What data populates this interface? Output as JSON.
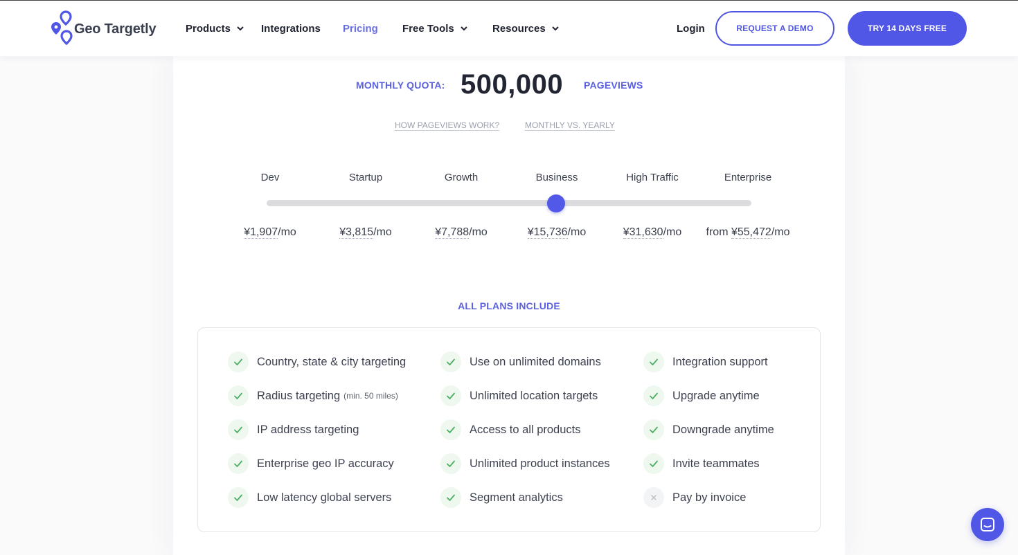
{
  "brand": {
    "name": "Geo Targetly",
    "accent": "#5056e6"
  },
  "nav": {
    "products": "Products",
    "integrations": "Integrations",
    "pricing": "Pricing",
    "free_tools": "Free Tools",
    "resources": "Resources",
    "login": "Login",
    "request_demo": "REQUEST A DEMO",
    "try_free": "TRY 14 DAYS FREE"
  },
  "quota": {
    "label": "MONTHLY QUOTA:",
    "value": "500,000",
    "unit": "PAGEVIEWS",
    "link_how": "HOW PAGEVIEWS WORK?",
    "link_monthly": "MONTHLY VS. YEARLY"
  },
  "tiers": [
    {
      "name": "Dev",
      "prefix": "",
      "amount": "¥1,907",
      "suffix": "/mo"
    },
    {
      "name": "Startup",
      "prefix": "",
      "amount": "¥3,815",
      "suffix": "/mo"
    },
    {
      "name": "Growth",
      "prefix": "",
      "amount": "¥7,788",
      "suffix": "/mo"
    },
    {
      "name": "Business",
      "prefix": "",
      "amount": "¥15,736",
      "suffix": "/mo"
    },
    {
      "name": "High Traffic",
      "prefix": "",
      "amount": "¥31,630",
      "suffix": "/mo"
    },
    {
      "name": "Enterprise",
      "prefix": "from ",
      "amount": "¥55,472",
      "suffix": "/mo"
    }
  ],
  "slider": {
    "selected_index": 3,
    "selected_tier": "Business"
  },
  "plans": {
    "title": "ALL PLANS INCLUDE",
    "columns": [
      [
        {
          "label": "Country, state & city targeting",
          "note": "",
          "included": true
        },
        {
          "label": "Radius targeting",
          "note": "(min. 50 miles)",
          "included": true
        },
        {
          "label": "IP address targeting",
          "note": "",
          "included": true
        },
        {
          "label": "Enterprise geo IP accuracy",
          "note": "",
          "included": true
        },
        {
          "label": "Low latency global servers",
          "note": "",
          "included": true
        }
      ],
      [
        {
          "label": "Use on unlimited domains",
          "note": "",
          "included": true
        },
        {
          "label": "Unlimited location targets",
          "note": "",
          "included": true
        },
        {
          "label": "Access to all products",
          "note": "",
          "included": true
        },
        {
          "label": "Unlimited product instances",
          "note": "",
          "included": true
        },
        {
          "label": "Segment analytics",
          "note": "",
          "included": true
        }
      ],
      [
        {
          "label": "Integration support",
          "note": "",
          "included": true
        },
        {
          "label": "Upgrade anytime",
          "note": "",
          "included": true
        },
        {
          "label": "Downgrade anytime",
          "note": "",
          "included": true
        },
        {
          "label": "Invite teammates",
          "note": "",
          "included": true
        },
        {
          "label": "Pay by invoice",
          "note": "",
          "included": false
        }
      ]
    ]
  },
  "chat": {
    "icon": "chat-icon"
  }
}
